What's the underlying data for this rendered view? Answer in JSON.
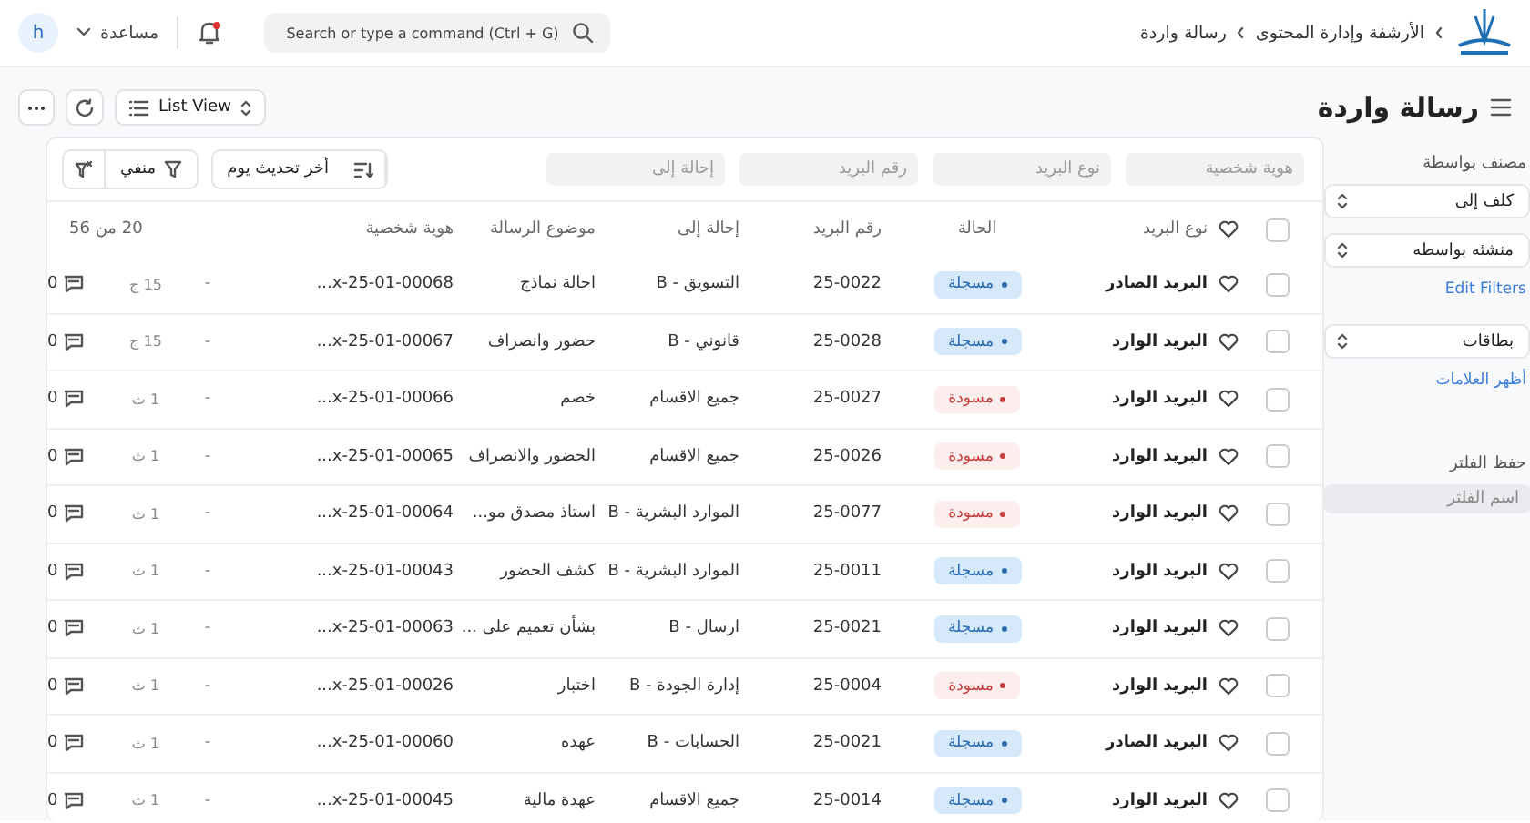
{
  "navbar": {
    "breadcrumbs": [
      "الأرشفة وإدارة المحتوى",
      "رسالة واردة"
    ],
    "search": {
      "placeholder": "Search or type a command (Ctrl + G)"
    },
    "notifications": {
      "unread": true
    },
    "help": "مساعدة",
    "avatar": "h"
  },
  "page": {
    "title": "رسالة واردة",
    "view_button": "List View"
  },
  "sidebar": {
    "group_by_label": "مصنف بواسطة",
    "selects": [
      "كلف إلى",
      "منشئه بواسطه"
    ],
    "edit_filters": "Edit Filters",
    "tags_select": "بطاقات",
    "show_tags": "أظهر العلامات",
    "save_filter_label": "حفظ الفلتر",
    "filter_name": {
      "placeholder": "اسم الفلتر"
    }
  },
  "filters": [
    {
      "placeholder": "هوية شخصية"
    },
    {
      "placeholder": "نوع البريد"
    },
    {
      "placeholder": "رقم البريد"
    },
    {
      "placeholder": "إحالة إلى"
    }
  ],
  "filter_button": "منفي",
  "sort_button": "أخر تحديث يوم",
  "table": {
    "select_all": {
      "checked": false
    },
    "columns": [
      "نوع البريد",
      "الحالة",
      "رقم البريد",
      "إحالة إلى",
      "موضوع الرسالة",
      "هوية شخصية"
    ],
    "count": "20 من 56",
    "rows": [
      {
        "checked": false,
        "liked": false,
        "type": "البريد الصادر",
        "status": {
          "label": "مسجلة",
          "kind": "registered"
        },
        "number": "25-0022",
        "referral": "التسويق - B",
        "subject": "احالة نماذج",
        "id": "...x-25-01-00068",
        "assigned": "-",
        "time": "15 ج",
        "comments": "0"
      },
      {
        "checked": false,
        "liked": false,
        "type": "البريد الوارد",
        "status": {
          "label": "مسجلة",
          "kind": "registered"
        },
        "number": "25-0028",
        "referral": "قانوني - B",
        "subject": "حضور وانصراف",
        "id": "...x-25-01-00067",
        "assigned": "-",
        "time": "15 ج",
        "comments": "0"
      },
      {
        "checked": false,
        "liked": false,
        "type": "البريد الوارد",
        "status": {
          "label": "مسودة",
          "kind": "draft"
        },
        "number": "25-0027",
        "referral": "جميع الاقسام",
        "subject": "خصم",
        "id": "...x-25-01-00066",
        "assigned": "-",
        "time": "1 ث",
        "comments": "0"
      },
      {
        "checked": false,
        "liked": false,
        "type": "البريد الوارد",
        "status": {
          "label": "مسودة",
          "kind": "draft"
        },
        "number": "25-0026",
        "referral": "جميع الاقسام",
        "subject": "الحضور والانصراف",
        "id": "...x-25-01-00065",
        "assigned": "-",
        "time": "1 ث",
        "comments": "0"
      },
      {
        "checked": false,
        "liked": false,
        "type": "البريد الوارد",
        "status": {
          "label": "مسودة",
          "kind": "draft"
        },
        "number": "25-0077",
        "referral": "الموارد البشرية - B",
        "subject": "استاذ مصدق مو...",
        "id": "...x-25-01-00064",
        "assigned": "-",
        "time": "1 ث",
        "comments": "0"
      },
      {
        "checked": false,
        "liked": false,
        "type": "البريد الوارد",
        "status": {
          "label": "مسجلة",
          "kind": "registered"
        },
        "number": "25-0011",
        "referral": "الموارد البشرية - B",
        "subject": "كشف الحضور",
        "id": "...x-25-01-00043",
        "assigned": "-",
        "time": "1 ث",
        "comments": "0"
      },
      {
        "checked": false,
        "liked": false,
        "type": "البريد الوارد",
        "status": {
          "label": "مسجلة",
          "kind": "registered"
        },
        "number": "25-0021",
        "referral": "ارسال - B",
        "subject": "بشأن تعميم على ...",
        "id": "...x-25-01-00063",
        "assigned": "-",
        "time": "1 ث",
        "comments": "0"
      },
      {
        "checked": false,
        "liked": false,
        "type": "البريد الوارد",
        "status": {
          "label": "مسودة",
          "kind": "draft"
        },
        "number": "25-0004",
        "referral": "إدارة الجودة - B",
        "subject": "اختبار",
        "id": "...x-25-01-00026",
        "assigned": "-",
        "time": "1 ث",
        "comments": "0"
      },
      {
        "checked": false,
        "liked": false,
        "type": "البريد الصادر",
        "status": {
          "label": "مسجلة",
          "kind": "registered"
        },
        "number": "25-0021",
        "referral": "الحسابات - B",
        "subject": "عهده",
        "id": "...x-25-01-00060",
        "assigned": "-",
        "time": "1 ث",
        "comments": "0"
      },
      {
        "checked": false,
        "liked": false,
        "type": "البريد الوارد",
        "status": {
          "label": "مسجلة",
          "kind": "registered"
        },
        "number": "25-0014",
        "referral": "جميع الاقسام",
        "subject": "عهدة مالية",
        "id": "...x-25-01-00045",
        "assigned": "-",
        "time": "1 ث",
        "comments": "0"
      }
    ]
  }
}
